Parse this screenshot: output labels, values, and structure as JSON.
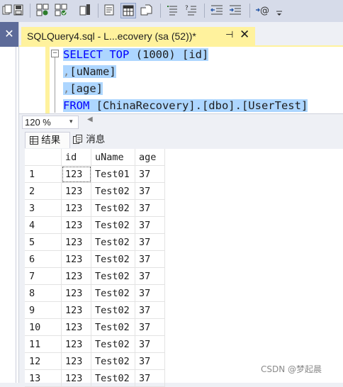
{
  "toolbar": {
    "icons": [
      "copy-icon",
      "save-icon",
      "query-options-icon",
      "intellisense-icon",
      "include-plan-icon",
      "results-to-text-icon",
      "results-to-grid-icon",
      "results-to-file-icon",
      "comment-icon",
      "uncomment-icon",
      "decrease-indent-icon",
      "increase-indent-icon",
      "specify-values-icon",
      "more-icon"
    ]
  },
  "left_panel": {
    "close_glyph": "✕"
  },
  "document_tab": {
    "title": "SQLQuery4.sql - L...ecovery (sa (52))*",
    "pin_glyph": "⊣",
    "close_glyph": "✕"
  },
  "editor": {
    "fold_glyph": "−",
    "lines": [
      {
        "kw": "SELECT TOP",
        "rest": " (1000) [id]"
      },
      {
        "prefix": ",",
        "rest": "[uName]"
      },
      {
        "prefix": ",",
        "rest": "[age]"
      },
      {
        "kw": "FROM",
        "rest": " [ChinaRecovery].[dbo].[UserTest]"
      }
    ]
  },
  "zoom": {
    "value": "120 %",
    "arrow": "▾"
  },
  "results_tabs": {
    "results": "结果",
    "messages": "消息"
  },
  "grid": {
    "columns": [
      "id",
      "uName",
      "age"
    ],
    "rows": [
      {
        "n": "1",
        "id": "123",
        "uName": "Test01",
        "age": "37"
      },
      {
        "n": "2",
        "id": "123",
        "uName": "Test02",
        "age": "37"
      },
      {
        "n": "3",
        "id": "123",
        "uName": "Test02",
        "age": "37"
      },
      {
        "n": "4",
        "id": "123",
        "uName": "Test02",
        "age": "37"
      },
      {
        "n": "5",
        "id": "123",
        "uName": "Test02",
        "age": "37"
      },
      {
        "n": "6",
        "id": "123",
        "uName": "Test02",
        "age": "37"
      },
      {
        "n": "7",
        "id": "123",
        "uName": "Test02",
        "age": "37"
      },
      {
        "n": "8",
        "id": "123",
        "uName": "Test02",
        "age": "37"
      },
      {
        "n": "9",
        "id": "123",
        "uName": "Test02",
        "age": "37"
      },
      {
        "n": "10",
        "id": "123",
        "uName": "Test02",
        "age": "37"
      },
      {
        "n": "11",
        "id": "123",
        "uName": "Test02",
        "age": "37"
      },
      {
        "n": "12",
        "id": "123",
        "uName": "Test02",
        "age": "37"
      },
      {
        "n": "13",
        "id": "123",
        "uName": "Test02",
        "age": "37"
      }
    ]
  },
  "watermark": "CSDN @梦起晨"
}
